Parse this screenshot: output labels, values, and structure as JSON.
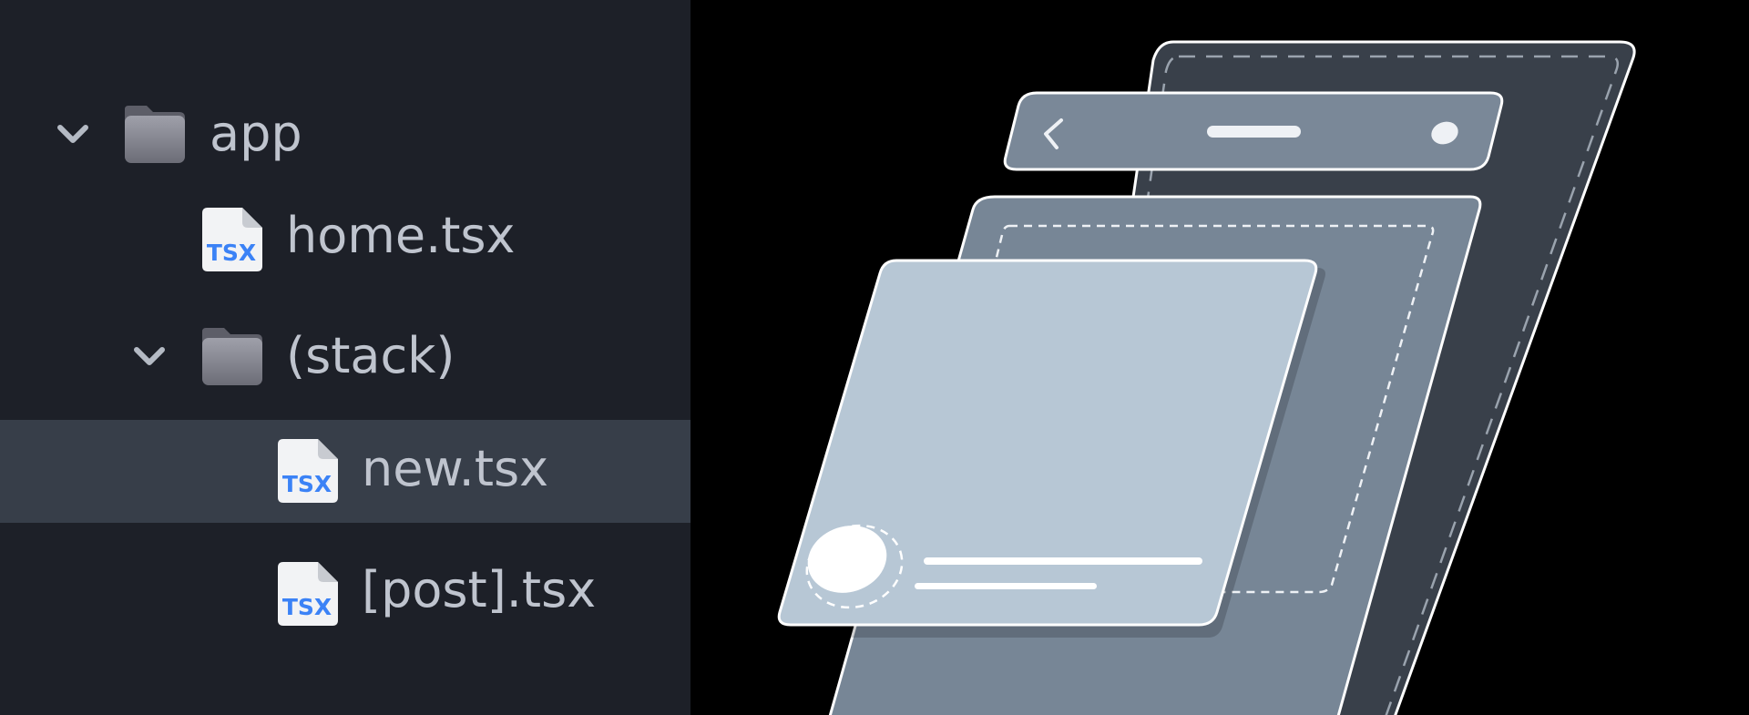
{
  "file_tree": {
    "items": [
      {
        "type": "folder",
        "expanded": true,
        "depth": 0,
        "label": "app",
        "chevron_icon": "chevron-down-icon",
        "icon": "folder-icon"
      },
      {
        "type": "file",
        "selected": false,
        "depth": 1,
        "label": "home.tsx",
        "icon": "tsx-file-icon",
        "badge": "TSX"
      },
      {
        "type": "folder",
        "expanded": true,
        "depth": 1,
        "label": "(stack)",
        "chevron_icon": "chevron-down-icon",
        "icon": "folder-icon"
      },
      {
        "type": "file",
        "selected": true,
        "depth": 2,
        "label": "new.tsx",
        "icon": "tsx-file-icon",
        "badge": "TSX"
      },
      {
        "type": "file",
        "selected": false,
        "depth": 2,
        "label": "[post].tsx",
        "icon": "tsx-file-icon",
        "badge": "TSX"
      }
    ]
  },
  "colors": {
    "sidebar_bg": "#1d2028",
    "selected_row_bg": "#373e49",
    "label_text": "#bfc4ce",
    "tsx_badge": "#3b82f6",
    "illustration_bg": "#000000"
  }
}
